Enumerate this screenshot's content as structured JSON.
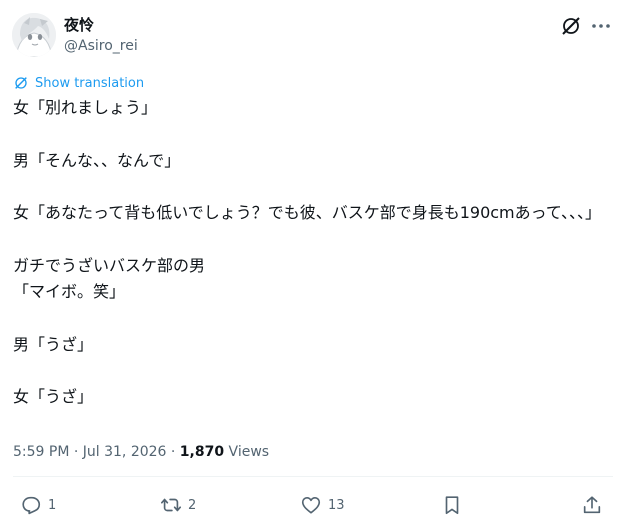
{
  "author": {
    "display_name": "夜怜",
    "handle": "@Asiro_rei",
    "avatar_icon": "anime-avatar"
  },
  "header_icons": {
    "grok": "grok-icon",
    "more": "more-icon"
  },
  "translation": {
    "label": "Show translation"
  },
  "tweet": {
    "text": "女「別れましょう」\n\n男「そんな、、なんで」\n\n女「あなたって背も低いでしょう？でも彼、バスケ部で身長も190cmあって、、、」\n\nガチでうざいバスケ部の男\n「マイボ。笑」\n\n男「うざ」\n\n女「うざ」"
  },
  "meta": {
    "time_date": "5:59 PM · Jul 31, 2026 · ",
    "views_count": "1,870",
    "views_label": " Views"
  },
  "actions": {
    "replies": "1",
    "reposts": "2",
    "likes": "13"
  },
  "colors": {
    "accent": "#1d9bf0",
    "text": "#0f1419",
    "muted": "#536471"
  }
}
